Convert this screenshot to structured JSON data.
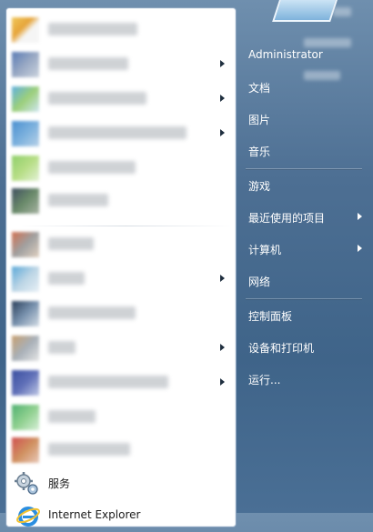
{
  "right_menu": {
    "items": [
      {
        "label": "Administrator"
      },
      {
        "label": "文档"
      },
      {
        "label": "图片"
      },
      {
        "label": "音乐"
      },
      {
        "label": "游戏"
      },
      {
        "label": "最近使用的项目"
      },
      {
        "label": "计算机"
      },
      {
        "label": "网络"
      },
      {
        "label": "控制面板"
      },
      {
        "label": "设备和打印机"
      },
      {
        "label": "运行..."
      }
    ]
  },
  "left_menu": {
    "services_label": "服务",
    "ie_label": "Internet Explorer"
  },
  "colors": {
    "panel_bg": "#ffffff",
    "right_bg": "#4d6f93",
    "text_dark": "#1b1b1b",
    "text_light": "#ffffff"
  }
}
